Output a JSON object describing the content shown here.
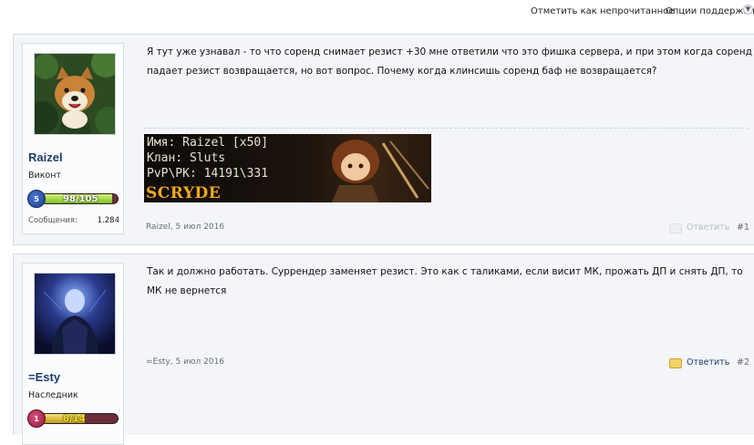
{
  "top_links": {
    "mark_unread": "Отметить как непрочитанное",
    "support_options": "Опции поддержки"
  },
  "posts": [
    {
      "username": "Raizel",
      "user_title": "Виконт",
      "level": "5",
      "xp_text": "98/105",
      "xp_fraction": 0.93,
      "stats_label": "Сообщения:",
      "stats_value": "1.284",
      "message": "Я тут уже узнавал - то что соренд снимает резист +30 мне ответили что это фишка сервера, и при этом когда соренд падает резист возвращается, но вот вопрос. Почему когда клинсишь соренд баф не возвращается?",
      "signature": {
        "name_line": "Имя: Raizel [x50]",
        "clan_line": "Клан: Sluts",
        "pvp_line": "PvP\\PK: 14191\\331",
        "logo": "SCRYDE"
      },
      "meta": "Raizel, 5 июл 2016",
      "reply_label": "Ответить",
      "number": "#1"
    },
    {
      "username": "=Esty",
      "user_title": "Наследник",
      "level": "1",
      "xp_text": "8/14",
      "xp_fraction": 0.57,
      "message": "Так и должно работать. Суррендер заменяет резист. Это как с таликами, если висит МК, прожать ДП и снять ДП, то МК не вернется",
      "meta": "=Esty, 5 июл 2016",
      "reply_label": "Ответить",
      "number": "#2"
    }
  ]
}
